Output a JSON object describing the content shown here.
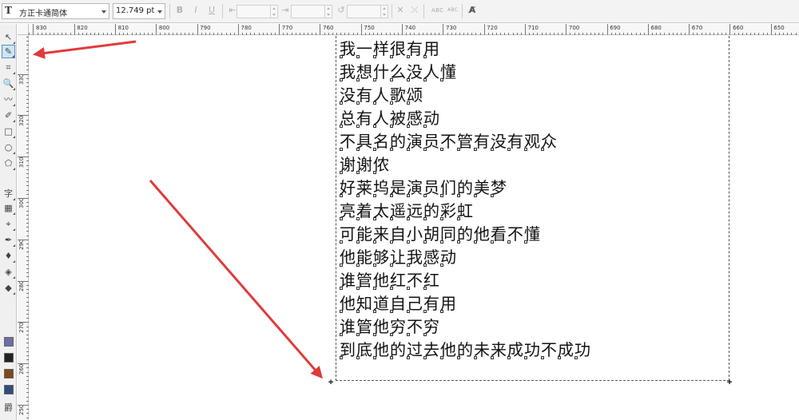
{
  "propbar": {
    "font_name": "方正卡通简体",
    "font_size": "12.749 pt",
    "font_icon": "font-T-icon",
    "abc_upper": "ABC",
    "abc_lower": "ABC"
  },
  "toolbox": {
    "tools": [
      {
        "name": "pick-tool-icon",
        "glyph": "↖"
      },
      {
        "name": "shape-tool-icon",
        "glyph": "✎",
        "active": true
      },
      {
        "name": "crop-tool-icon",
        "glyph": "⌗"
      },
      {
        "name": "zoom-tool-icon",
        "glyph": "🔍"
      },
      {
        "name": "freehand-tool-icon",
        "glyph": "〰"
      },
      {
        "name": "smart-fill-icon",
        "glyph": "✐"
      },
      {
        "name": "rectangle-tool-icon",
        "glyph": "□"
      },
      {
        "name": "ellipse-tool-icon",
        "glyph": "○"
      },
      {
        "name": "polygon-tool-icon",
        "glyph": "⬠"
      },
      {
        "name": "text-tool-icon",
        "glyph": "字"
      },
      {
        "name": "table-tool-icon",
        "glyph": "▦"
      },
      {
        "name": "dimension-tool-icon",
        "glyph": "⌖"
      },
      {
        "name": "eyedropper-tool-icon",
        "glyph": "✒"
      },
      {
        "name": "outline-pen-icon",
        "glyph": "♦"
      },
      {
        "name": "fill-tool-icon",
        "glyph": "◈"
      },
      {
        "name": "interactive-fill-icon",
        "glyph": "◆"
      }
    ],
    "swatches": [
      "#6a6fa8",
      "#222222",
      "#7a4a1a",
      "#2c4e7a"
    ],
    "bottom_glyph": "爵"
  },
  "ruler": {
    "top_labels": [
      "830",
      "820",
      "810",
      "800",
      "790",
      "780",
      "770",
      "760",
      "750",
      "740",
      "730",
      "720",
      "710",
      "700",
      "690",
      "680",
      "670",
      "660",
      "650"
    ],
    "left_labels": [
      "330",
      "320",
      "310",
      "300",
      "290",
      "280",
      "270",
      "260",
      "250"
    ]
  },
  "text_frame": {
    "lines": [
      "我一样很有用",
      "我想什么没人懂",
      "没有人歌颂",
      "总有人被感动",
      "不具名的演员不管有没有观众",
      "谢谢侬",
      "好莱坞是演员们的美梦",
      "亮着太遥远的彩虹",
      "可能来自小胡同的他看不懂",
      "他能够让我感动",
      "谁管他红不红",
      "他知道自己有用",
      "谁管他穷不穷",
      "到底他的过去他的未来成功不成功"
    ]
  },
  "annotations": {
    "arrow_color": "#e03a3a"
  }
}
